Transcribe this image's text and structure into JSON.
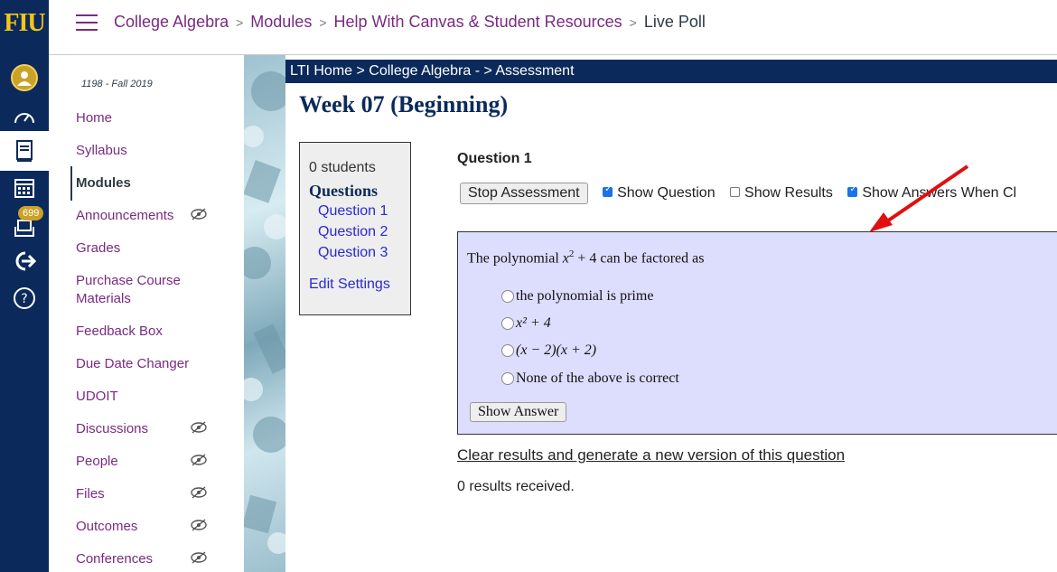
{
  "global_nav": {
    "logo": "FIU",
    "badge_count": "699"
  },
  "breadcrumb": [
    "College Algebra",
    "Modules",
    "Help With Canvas & Student Resources",
    "Live Poll"
  ],
  "course_nav": {
    "term": "1198 - Fall 2019",
    "items": [
      {
        "label": "Home",
        "hidden": false
      },
      {
        "label": "Syllabus",
        "hidden": false
      },
      {
        "label": "Modules",
        "hidden": false,
        "active": true
      },
      {
        "label": "Announcements",
        "hidden": true
      },
      {
        "label": "Grades",
        "hidden": false
      },
      {
        "label": "Purchase Course Materials",
        "hidden": false
      },
      {
        "label": "Feedback Box",
        "hidden": false
      },
      {
        "label": "Due Date Changer",
        "hidden": false
      },
      {
        "label": "UDOIT",
        "hidden": false
      },
      {
        "label": "Discussions",
        "hidden": true
      },
      {
        "label": "People",
        "hidden": true
      },
      {
        "label": "Files",
        "hidden": true
      },
      {
        "label": "Outcomes",
        "hidden": true
      },
      {
        "label": "Conferences",
        "hidden": true
      }
    ]
  },
  "lti": {
    "bar": "LTI Home > College Algebra - > Assessment",
    "title": "Week 07 (Beginning)",
    "sidebar": {
      "students": "0 students",
      "questions_heading": "Questions",
      "questions": [
        "Question 1",
        "Question 2",
        "Question 3"
      ],
      "edit_settings": "Edit Settings"
    },
    "question_label": "Question 1",
    "stop_button": "Stop Assessment",
    "show_question": {
      "label": "Show Question",
      "checked": true
    },
    "show_results": {
      "label": "Show Results",
      "checked": false
    },
    "show_answers": {
      "label": "Show Answers When Cl",
      "checked": true
    },
    "prompt_pre": "The polynomial ",
    "prompt_post": " can be factored as",
    "choices": [
      "the polynomial is prime",
      "x² + 4",
      "(x − 2)(x + 2)",
      "None of the above is correct"
    ],
    "show_answer_button": "Show Answer",
    "clear_link": "Clear results and generate a new version of this question",
    "results": "0 results received."
  }
}
